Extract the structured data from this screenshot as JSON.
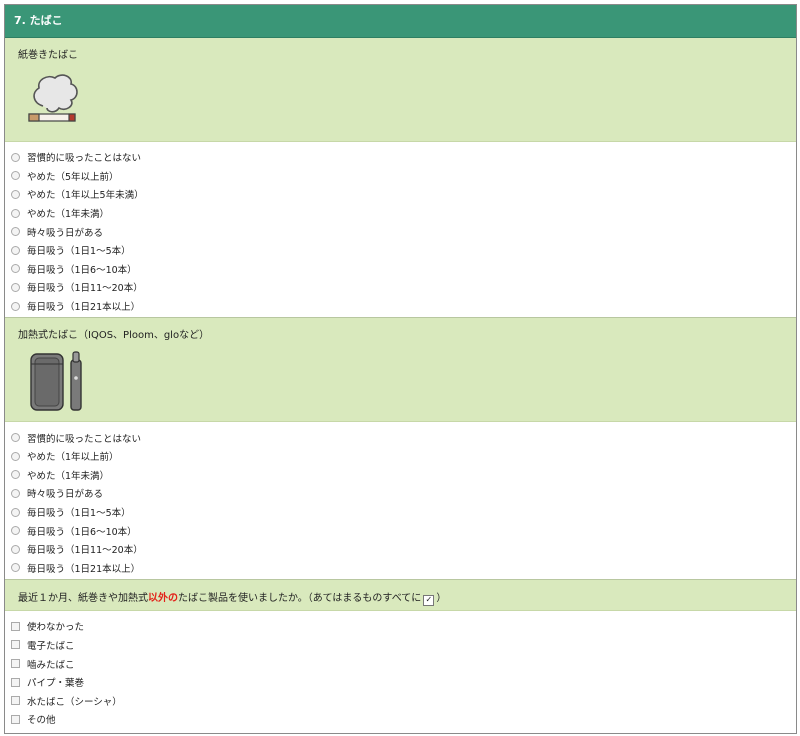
{
  "header": {
    "title": "7.  たばこ"
  },
  "section1": {
    "title": "紙巻きたばこ",
    "image_icon": "cigarette-smoke-icon",
    "options": [
      "習慣的に吸ったことはない",
      "やめた（5年以上前）",
      "やめた（1年以上5年未満）",
      "やめた（1年未満）",
      "時々吸う日がある",
      "毎日吸う（1日1～5本）",
      "毎日吸う（1日6～10本）",
      "毎日吸う（1日11～20本）",
      "毎日吸う（1日21本以上）"
    ]
  },
  "section2": {
    "title": "加熱式たばこ（IQOS、Ploom、gloなど）",
    "image_icon": "heated-tobacco-device-icon",
    "options": [
      "習慣的に吸ったことはない",
      "やめた（1年以上前）",
      "やめた（1年未満）",
      "時々吸う日がある",
      "毎日吸う（1日1～5本）",
      "毎日吸う（1日6～10本）",
      "毎日吸う（1日11～20本）",
      "毎日吸う（1日21本以上）"
    ]
  },
  "section3": {
    "title_pre": "最近１か月、紙巻きや加熱式",
    "title_highlight": "以外の",
    "title_post": "たばこ製品を使いましたか。（あてはまるものすべてに",
    "title_check": "✓",
    "title_end": "）",
    "options": [
      "使わなかった",
      "電子たばこ",
      "嚙みたばこ",
      "パイプ・葉巻",
      "水たばこ（シーシャ）",
      "その他"
    ]
  },
  "colors": {
    "header": "#3a9677",
    "question_bg": "#d9e9bd",
    "highlight": "#e3231a"
  }
}
